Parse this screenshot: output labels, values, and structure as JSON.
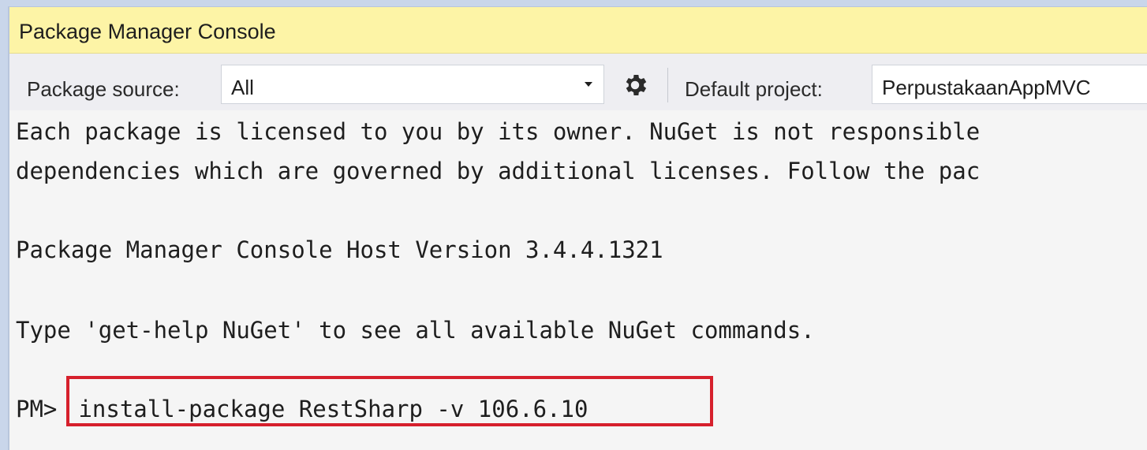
{
  "window": {
    "title": "Package Manager Console"
  },
  "toolbar": {
    "package_source_label": "Package source:",
    "package_source_value": "All",
    "settings_icon": "gear-icon",
    "default_project_label": "Default project:",
    "default_project_value": "PerpustakaanAppMVC"
  },
  "console": {
    "lines": [
      "Each package is licensed to you by its owner. NuGet is not responsible",
      "dependencies which are governed by additional licenses. Follow the pac",
      "Package Manager Console Host Version 3.4.4.1321",
      "Type 'get-help NuGet' to see all available NuGet commands."
    ],
    "prompt": "PM>",
    "command": " install-package RestSharp -v 106.6.10"
  },
  "colors": {
    "title_bar": "#fdf4a6",
    "highlight_border": "#d6202c"
  }
}
